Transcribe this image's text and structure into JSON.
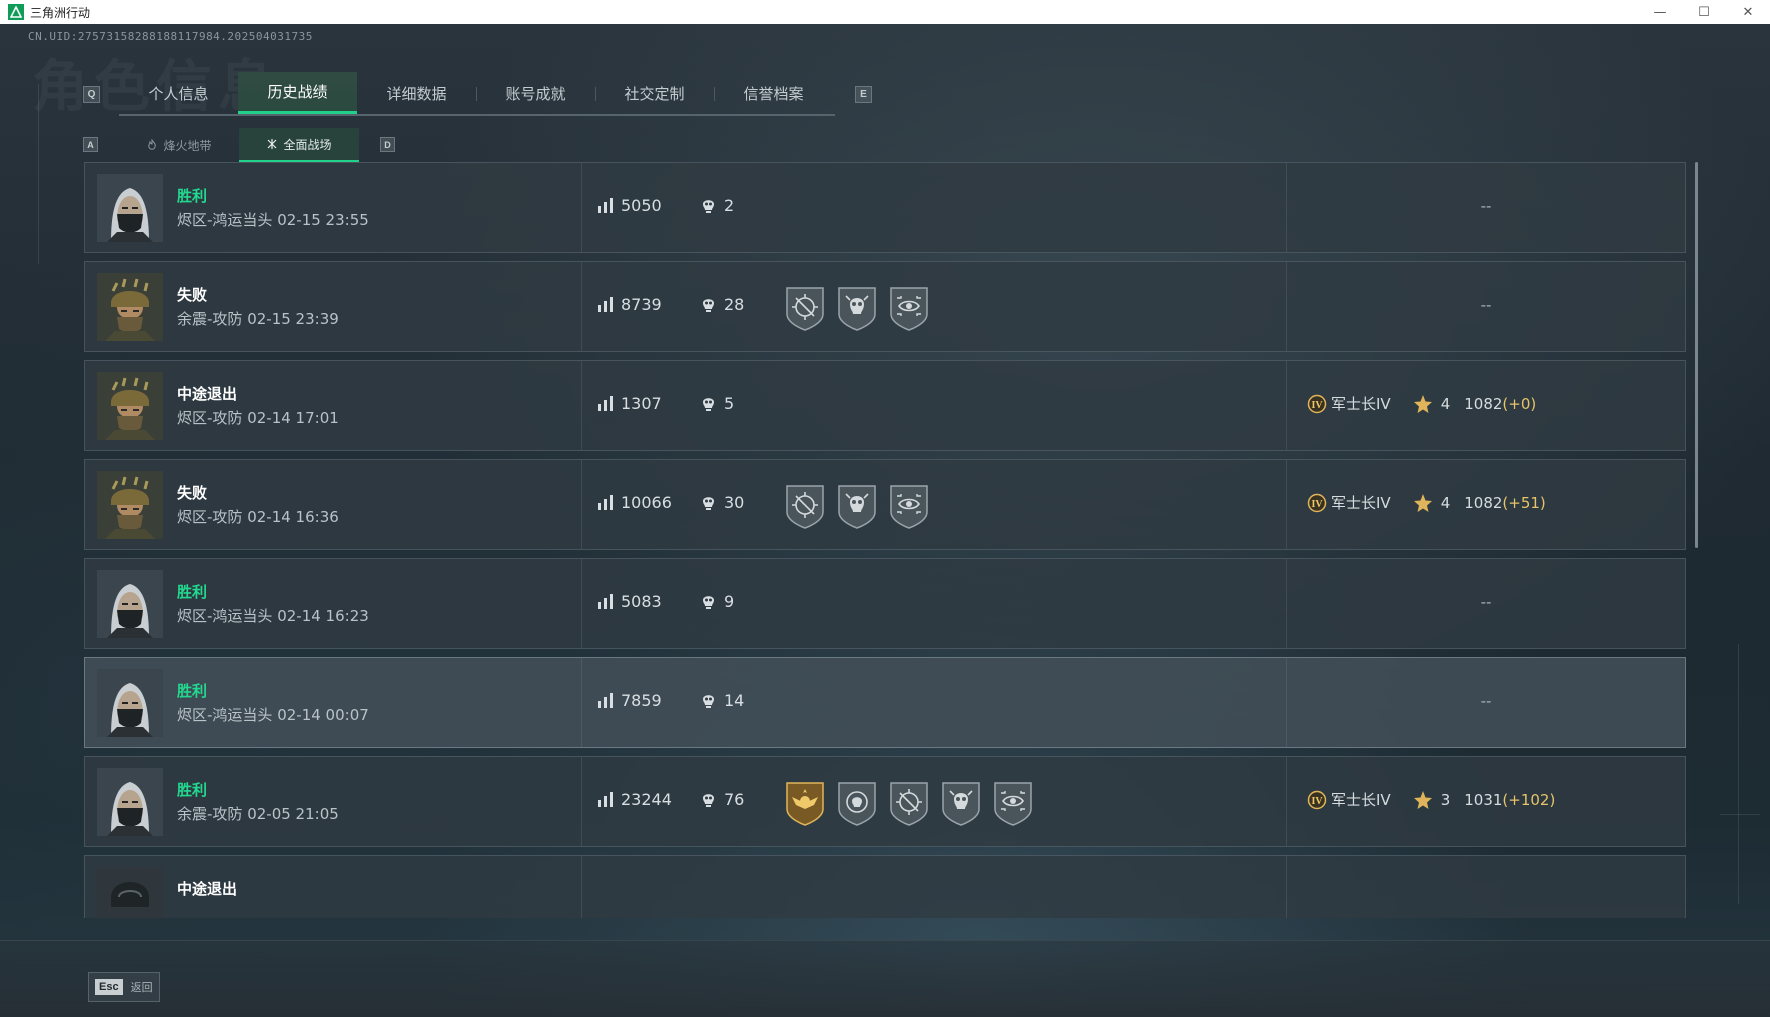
{
  "window": {
    "title": "三角洲行动",
    "controls": {
      "minimize": "—",
      "maximize": "☐",
      "close": "✕"
    }
  },
  "uid": "CN.UID:275731582881881179​84.202504031735",
  "watermark": "角色信息",
  "tabs": {
    "prev_key": "Q",
    "next_key": "E",
    "items": [
      {
        "label": "个人信息",
        "active": false
      },
      {
        "label": "历史战绩",
        "active": true
      },
      {
        "label": "详细数据",
        "active": false
      },
      {
        "label": "账号成就",
        "active": false
      },
      {
        "label": "社交定制",
        "active": false
      },
      {
        "label": "信誉档案",
        "active": false
      }
    ]
  },
  "subtabs": {
    "prev_key": "A",
    "next_key": "D",
    "items": [
      {
        "label": "烽火地带",
        "active": false,
        "icon": "flame-icon"
      },
      {
        "label": "全面战场",
        "active": true,
        "icon": "crossed-swords-icon"
      }
    ]
  },
  "colors": {
    "win": "#22d98f",
    "accent": "#1fd18a",
    "delta": "#e6c46a"
  },
  "matches": [
    {
      "result": "胜利",
      "win": true,
      "avatar": "female-masked",
      "map": "烬区-鸿运当头",
      "time": "02-15 23:55",
      "score": "5050",
      "kills": "2",
      "medals": [],
      "rank": null,
      "rank_placeholder": "--"
    },
    {
      "result": "失败",
      "win": false,
      "avatar": "male-helmet",
      "map": "余震-攻防",
      "time": "02-15 23:39",
      "score": "8739",
      "kills": "28",
      "medals": [
        "crosshair-medal",
        "skull-medal",
        "eye-medal"
      ],
      "rank": null,
      "rank_placeholder": "--"
    },
    {
      "result": "中途退出",
      "win": false,
      "avatar": "male-helmet",
      "map": "烬区-攻防",
      "time": "02-14 17:01",
      "score": "1307",
      "kills": "5",
      "medals": [],
      "rank": {
        "tier": "军士长IV",
        "stars": "4",
        "points": "1082",
        "delta": "(+0)"
      }
    },
    {
      "result": "失败",
      "win": false,
      "avatar": "male-helmet",
      "map": "烬区-攻防",
      "time": "02-14 16:36",
      "score": "10066",
      "kills": "30",
      "medals": [
        "crosshair-medal",
        "skull-medal",
        "eye-medal"
      ],
      "rank": {
        "tier": "军士长IV",
        "stars": "4",
        "points": "1082",
        "delta": "(+51)"
      }
    },
    {
      "result": "胜利",
      "win": true,
      "avatar": "female-masked",
      "map": "烬区-鸿运当头",
      "time": "02-14 16:23",
      "score": "5083",
      "kills": "9",
      "medals": [],
      "rank": null,
      "rank_placeholder": "--"
    },
    {
      "result": "胜利",
      "win": true,
      "avatar": "female-masked",
      "map": "烬区-鸿运当头",
      "time": "02-14 00:07",
      "score": "7859",
      "kills": "14",
      "medals": [],
      "rank": null,
      "rank_placeholder": "--",
      "highlight": true
    },
    {
      "result": "胜利",
      "win": true,
      "avatar": "female-masked",
      "map": "余震-攻防",
      "time": "02-05 21:05",
      "score": "23244",
      "kills": "76",
      "medals": [
        "gold-eagle-medal",
        "target-skull-medal",
        "crosshair-medal",
        "skull-medal",
        "eye-medal"
      ],
      "rank": {
        "tier": "军士长IV",
        "stars": "3",
        "points": "1031",
        "delta": "(+102)"
      }
    },
    {
      "result": "中途退出",
      "win": false,
      "avatar": "dark-helmet",
      "map": "",
      "time": "",
      "score": "",
      "kills": "",
      "medals": [],
      "rank": null,
      "rank_placeholder": ""
    }
  ],
  "footer": {
    "esc_key": "Esc",
    "esc_label": "返回"
  }
}
